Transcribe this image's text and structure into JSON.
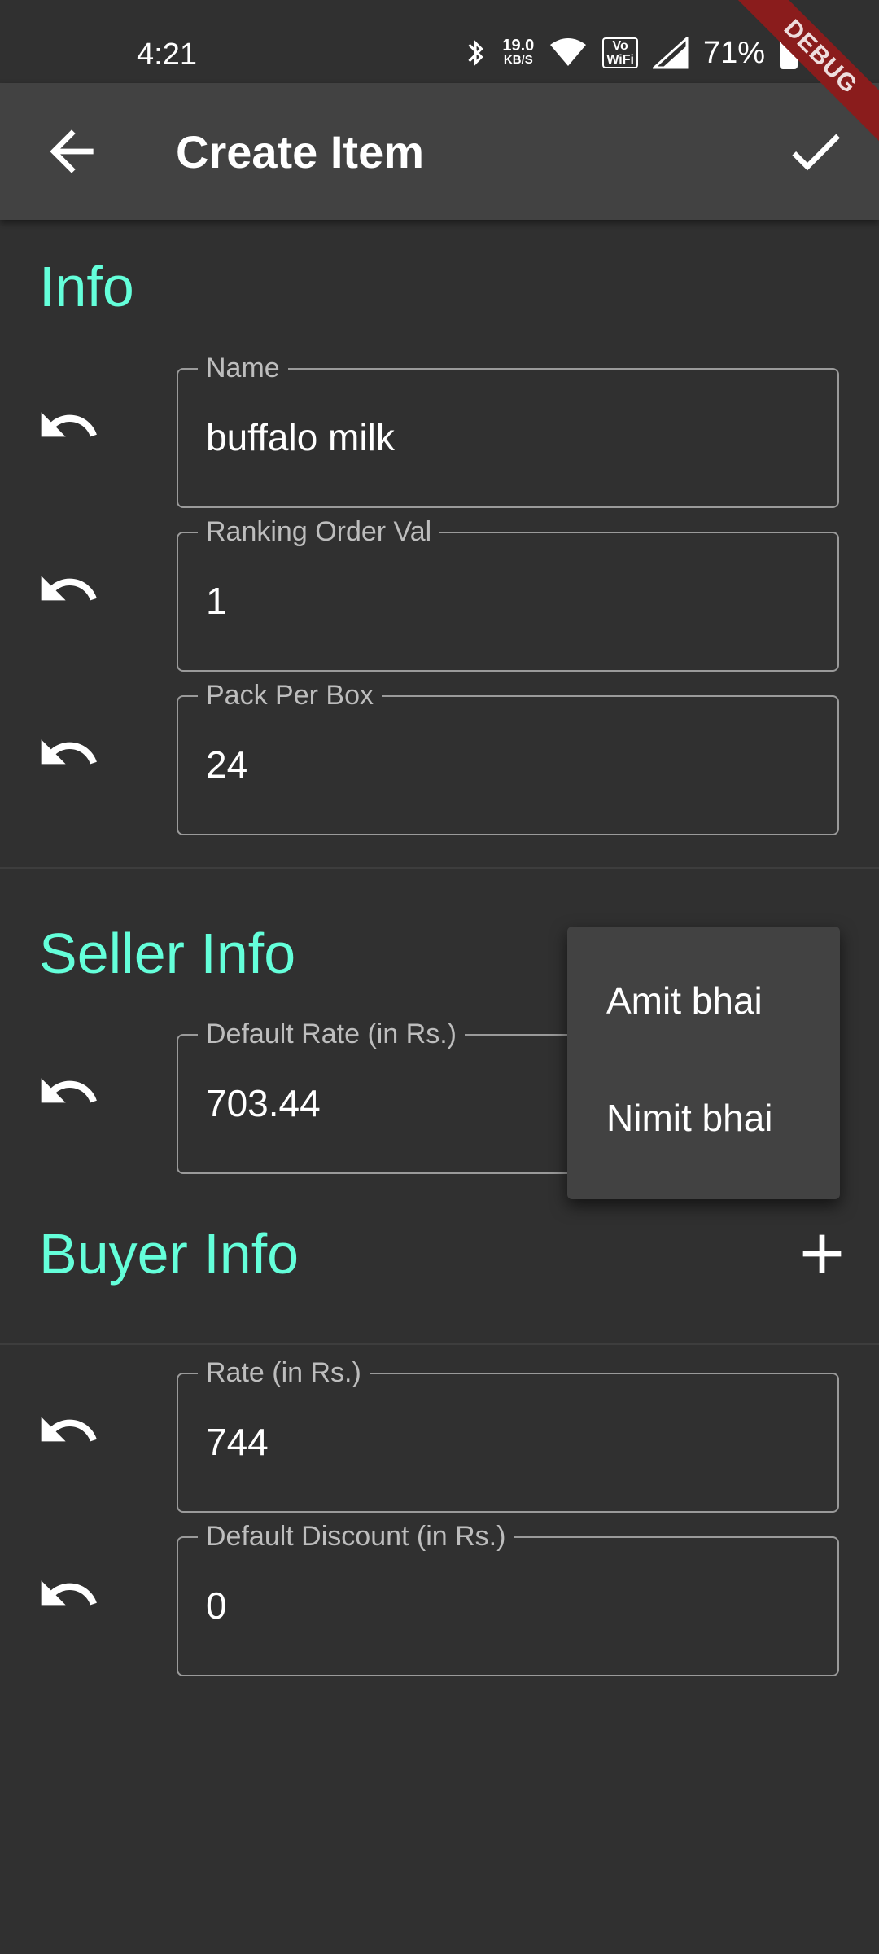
{
  "status_bar": {
    "time": "4:21",
    "net_speed_value": "19.0",
    "net_speed_unit": "KB/S",
    "vowifi_line1": "Vo",
    "vowifi_line2": "WiFi",
    "battery": "71%"
  },
  "debug_banner": "DEBUG",
  "app_bar": {
    "title": "Create Item"
  },
  "sections": {
    "info": {
      "title": "Info",
      "fields": [
        {
          "label": "Name",
          "value": "buffalo milk"
        },
        {
          "label": "Ranking Order Val",
          "value": "1"
        },
        {
          "label": "Pack Per Box",
          "value": "24"
        }
      ]
    },
    "seller": {
      "title": "Seller Info",
      "fields": [
        {
          "label": "Default Rate (in Rs.)",
          "value": "703.44"
        }
      ]
    },
    "buyer": {
      "title": "Buyer Info",
      "fields": [
        {
          "label": "Rate (in Rs.)",
          "value": "744"
        },
        {
          "label": "Default Discount (in Rs.)",
          "value": "0"
        }
      ]
    }
  },
  "popup_menu": {
    "items": [
      "Amit bhai",
      "Nimit bhai"
    ]
  },
  "colors": {
    "accent": "#64ffda",
    "background": "#303030",
    "app_bar": "#424242",
    "debug": "#8a1c1c"
  }
}
